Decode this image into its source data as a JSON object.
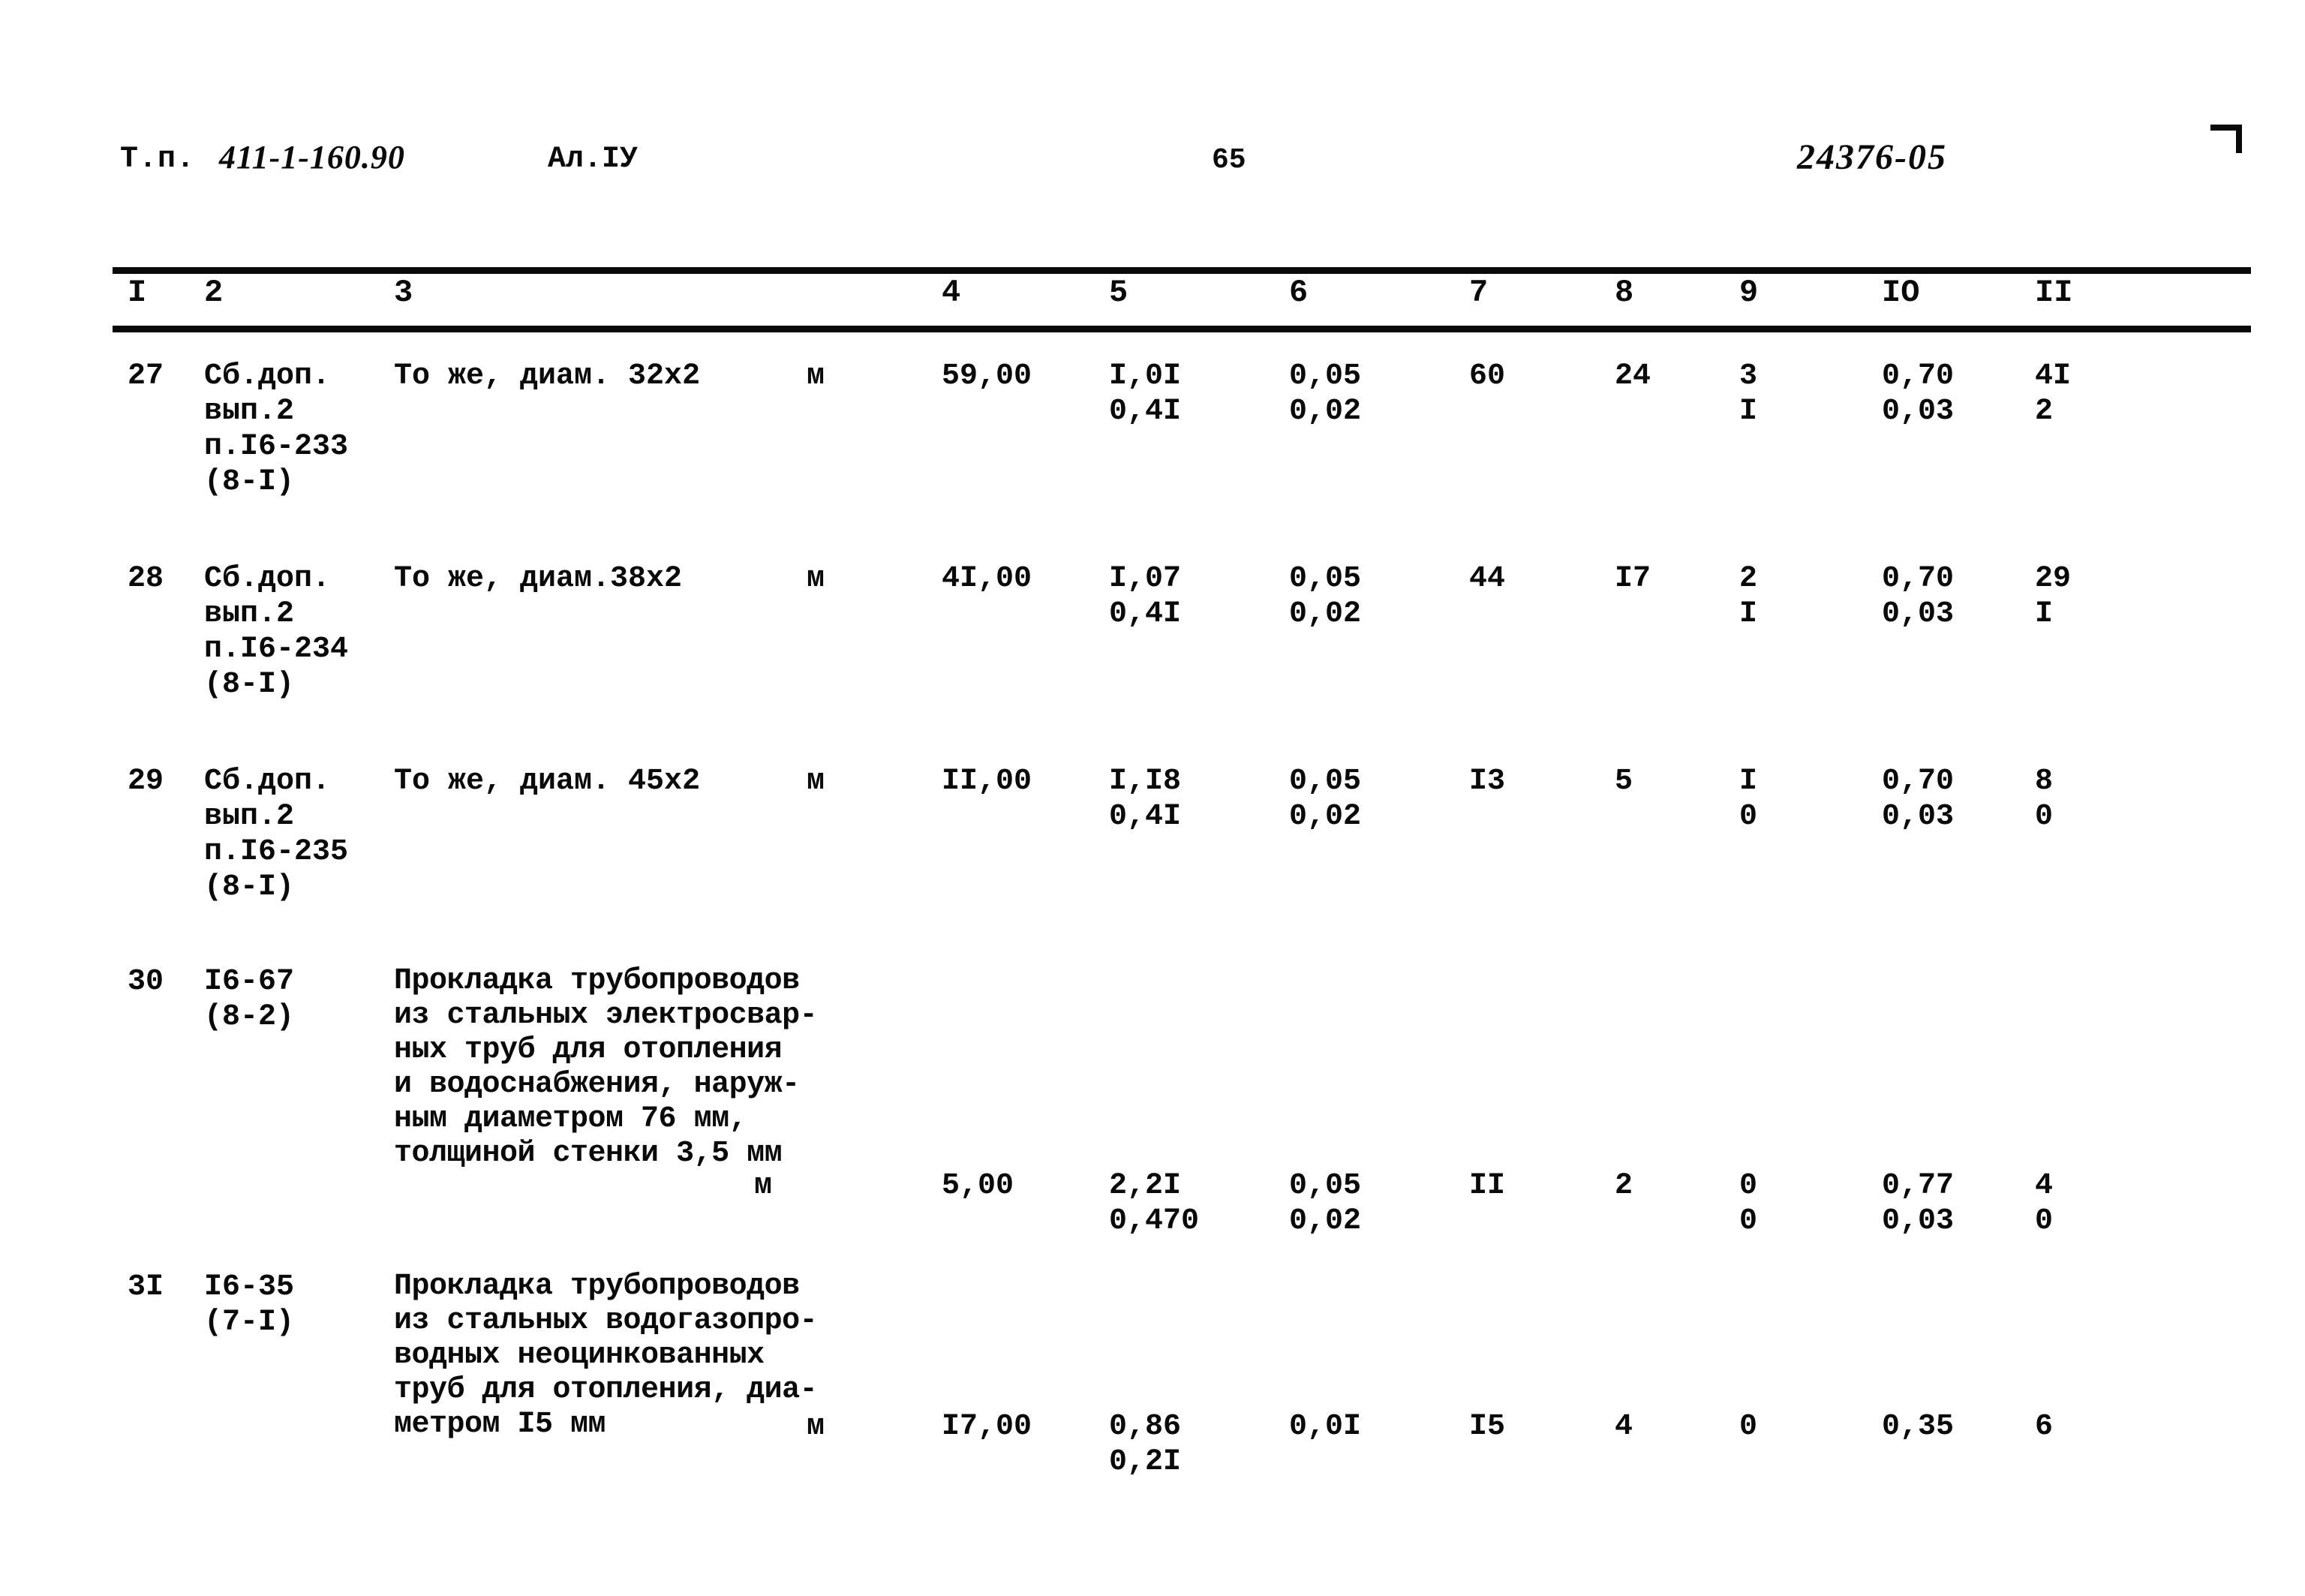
{
  "header": {
    "doc_prefix": "Т.п.",
    "doc_code": "411-1-160.90",
    "album": "Ал.IУ",
    "page_number": "65",
    "stamp_code": "24376-05"
  },
  "table": {
    "column_numbers": [
      "I",
      "2",
      "3",
      "4",
      "5",
      "6",
      "7",
      "8",
      "9",
      "IO",
      "II"
    ],
    "rows": [
      {
        "num": "27",
        "code": "Сб.доп.\nвып.2\nп.I6-233\n(8-I)",
        "description": "То же, диам. 32х2",
        "unit": "м",
        "c4": "59,00",
        "c5": "I,0I\n0,4I",
        "c6": "0,05\n0,02",
        "c7": "60",
        "c8": "24",
        "c9": "3\nI",
        "c10": "0,70\n0,03",
        "c11": "4I\n2"
      },
      {
        "num": "28",
        "code": "Сб.доп.\nвып.2\nп.I6-234\n(8-I)",
        "description": "То же, диам.38х2",
        "unit": "м",
        "c4": "4I,00",
        "c5": "I,07\n0,4I",
        "c6": "0,05\n0,02",
        "c7": "44",
        "c8": "I7",
        "c9": "2\nI",
        "c10": "0,70\n0,03",
        "c11": "29\nI"
      },
      {
        "num": "29",
        "code": "Сб.доп.\nвып.2\nп.I6-235\n(8-I)",
        "description": "То же, диам. 45х2",
        "unit": "м",
        "c4": "II,00",
        "c5": "I,I8\n0,4I",
        "c6": "0,05\n0,02",
        "c7": "I3",
        "c8": "5",
        "c9": "I\n0",
        "c10": "0,70\n0,03",
        "c11": "8\n0"
      },
      {
        "num": "30",
        "code": "I6-67\n(8-2)",
        "description": "Прокладка трубопроводов\nиз стальных электросвар-\nных труб для отопления\nи водоснабжения, наруж-\nным диаметром 76 мм,\nтолщиной стенки 3,5 мм",
        "unit": "м",
        "c4": "5,00",
        "c5": "2,2I\n0,470",
        "c6": "0,05\n0,02",
        "c7": "II",
        "c8": "2",
        "c9": "0\n0",
        "c10": "0,77\n0,03",
        "c11": "4\n0"
      },
      {
        "num": "3I",
        "code": "I6-35\n(7-I)",
        "description": "Прокладка трубопроводов\nиз стальных водогазопро-\nводных неоцинкованных\nтруб для отопления, диа-\nметром I5 мм",
        "unit": "м",
        "c4": "I7,00",
        "c5": "0,86\n0,2I",
        "c6": "0,0I",
        "c7": "I5",
        "c8": "4",
        "c9": "0",
        "c10": "0,35",
        "c11": "6"
      }
    ]
  }
}
